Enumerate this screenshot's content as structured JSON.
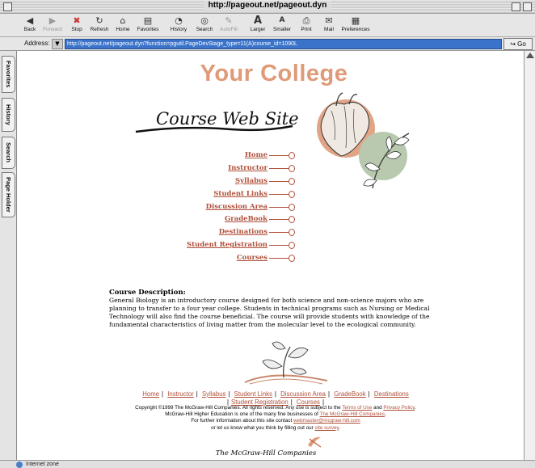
{
  "window": {
    "title": "http://pageout.net/pageout.dyn"
  },
  "toolbar": {
    "buttons": [
      {
        "label": "Back",
        "icon": "back-arrow-icon",
        "enabled": true
      },
      {
        "label": "Forward",
        "icon": "forward-arrow-icon",
        "enabled": false
      },
      {
        "label": "Stop",
        "icon": "stop-icon",
        "enabled": true
      },
      {
        "label": "Refresh",
        "icon": "refresh-icon",
        "enabled": true
      },
      {
        "label": "Home",
        "icon": "home-icon",
        "enabled": true
      },
      {
        "label": "Favorites",
        "icon": "favorites-icon",
        "enabled": true
      },
      {
        "label": "History",
        "icon": "history-icon",
        "enabled": true
      },
      {
        "label": "Search",
        "icon": "search-icon",
        "enabled": true
      },
      {
        "label": "AutoFill",
        "icon": "autofill-icon",
        "enabled": false
      },
      {
        "label": "Larger",
        "icon": "larger-text-icon",
        "enabled": true
      },
      {
        "label": "Smaller",
        "icon": "smaller-text-icon",
        "enabled": true
      },
      {
        "label": "Print",
        "icon": "print-icon",
        "enabled": true
      },
      {
        "label": "Mail",
        "icon": "mail-icon",
        "enabled": true
      },
      {
        "label": "Preferences",
        "icon": "preferences-icon",
        "enabled": true
      }
    ]
  },
  "address": {
    "label": "Address:",
    "url": "http://pageout.net/pageout.dyn?function=pgutil.PageDevStage_type=11(A)course_id=1090L",
    "go_label": "Go"
  },
  "sidetabs": [
    "Favorites",
    "History",
    "Search",
    "Page Holder"
  ],
  "page": {
    "brand": "Your College",
    "course_web_site": "Course Web Site",
    "nav": [
      "Home",
      "Instructor",
      "Syllabus",
      "Student Links",
      "Discussion Area",
      "GradeBook",
      "Destinations",
      "Student Registration",
      "Courses"
    ],
    "description": {
      "heading": "Course Description:",
      "text": "General Biology is an introductory course designed for both science and non-science majors who are planning to transfer to a four year college. Students in technical programs such as Nursing or Medical Technology will also find the course beneficial. The course will provide students with knowledge of the fundamental characteristics of living matter from the molecular level to the ecological community."
    },
    "footer_links": [
      "Home",
      "Instructor",
      "Syllabus",
      "Student Links",
      "Discussion Area",
      "GradeBook",
      "Destinations",
      "Student Registration",
      "Courses"
    ],
    "copyright": {
      "line1_a": "Copyright ©1999 The McGraw-Hill Companies. All rights reserved. Any use is subject to the ",
      "terms": "Terms of Use",
      "and": " and ",
      "privacy": "Privacy Policy",
      "line2_a": "McGraw-Hill Higher Education is one of the many fine businesses of ",
      "mcg_companies": "The McGraw-Hill Companies",
      "line3_a": "For further information about this site contact ",
      "email": "webmaster@mcgraw-hill.com",
      "line4_a": "or let us know what you think by filling out our ",
      "survey": "site survey"
    },
    "publisher": "The McGraw-Hill Companies"
  },
  "status": {
    "text": "Internet zone"
  },
  "colors": {
    "brand": "#e09a78",
    "link": "#b0503a",
    "url_bg": "#3a73c9"
  }
}
